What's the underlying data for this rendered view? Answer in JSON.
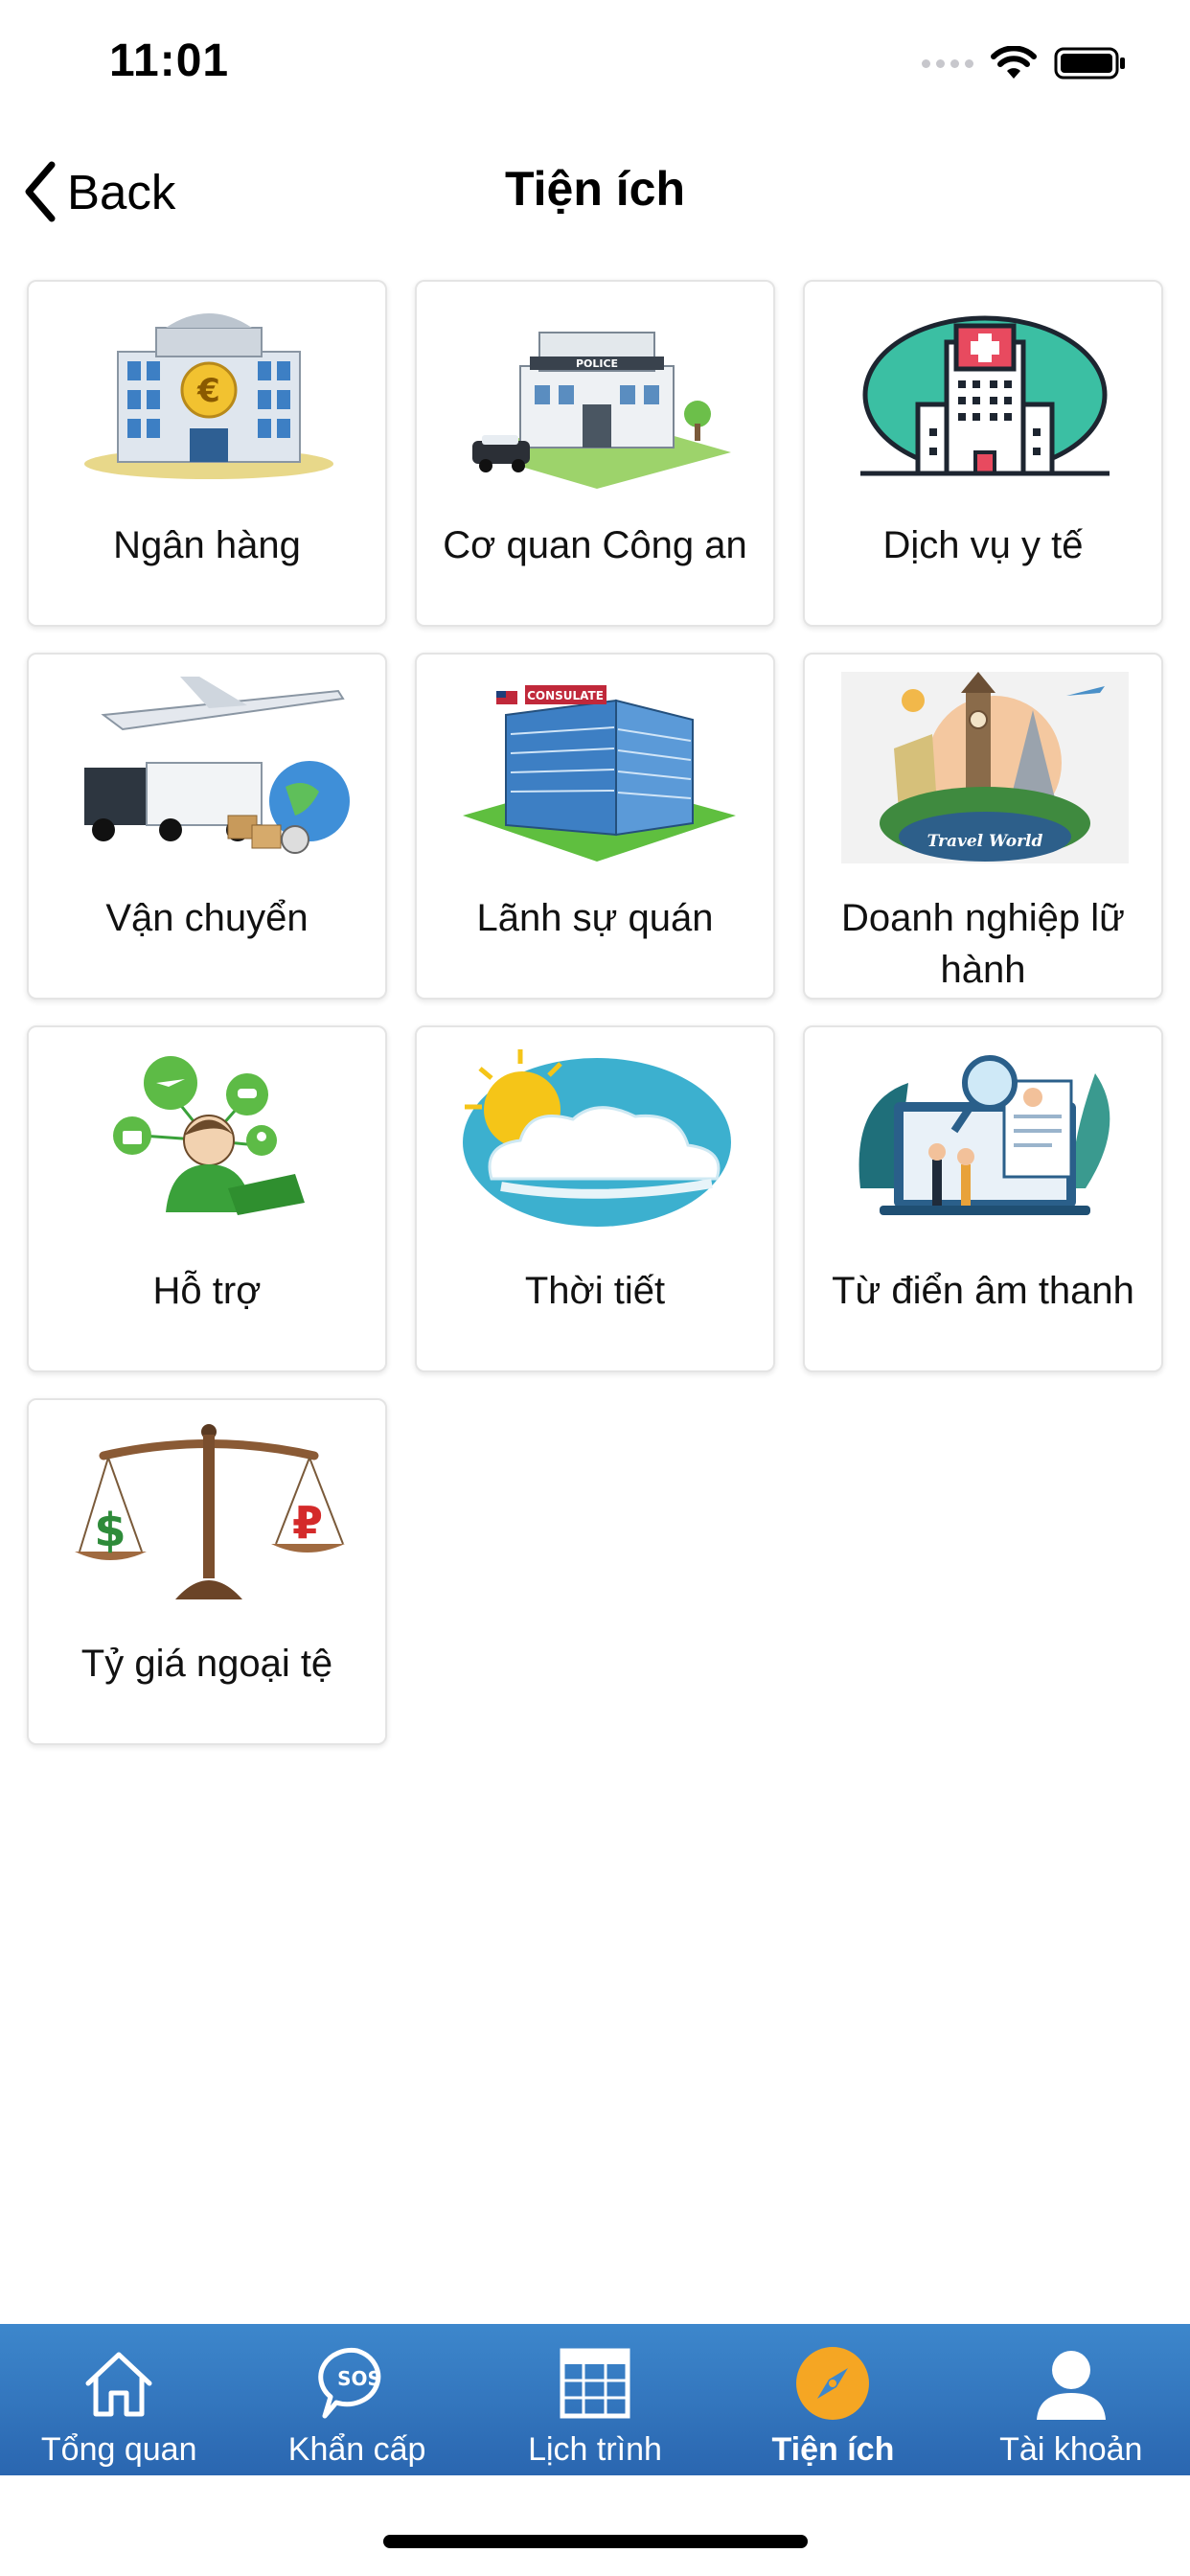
{
  "status_bar": {
    "time": "11:01"
  },
  "nav": {
    "back_label": "Back",
    "title": "Tiện ích"
  },
  "items": [
    {
      "label": "Ngân hàng",
      "icon": "bank-icon"
    },
    {
      "label": "Cơ quan Công an",
      "icon": "police-station-icon"
    },
    {
      "label": "Dịch vụ y tế",
      "icon": "hospital-icon"
    },
    {
      "label": "Vận chuyển",
      "icon": "transport-icon"
    },
    {
      "label": "Lãnh sự quán",
      "icon": "consulate-icon",
      "sign": "CONSULATE"
    },
    {
      "label": "Doanh nghiệp lữ hành",
      "icon": "travel-agency-icon",
      "sign": "Travel World"
    },
    {
      "label": "Hỗ trợ",
      "icon": "support-icon"
    },
    {
      "label": "Thời tiết",
      "icon": "weather-icon"
    },
    {
      "label": "Từ điển âm thanh",
      "icon": "audio-dictionary-icon"
    },
    {
      "label": "Tỷ giá ngoại tệ",
      "icon": "exchange-rate-icon"
    }
  ],
  "tabs": [
    {
      "label": "Tổng quan",
      "icon": "home-icon",
      "active": false
    },
    {
      "label": "Khẩn cấp",
      "icon": "sos-icon",
      "active": false
    },
    {
      "label": "Lịch trình",
      "icon": "calendar-grid-icon",
      "active": false
    },
    {
      "label": "Tiện ích",
      "icon": "compass-icon",
      "active": true
    },
    {
      "label": "Tài khoản",
      "icon": "user-icon",
      "active": false
    }
  ],
  "colors": {
    "tab_bar_top": "#3d87cc",
    "tab_bar_bottom": "#2a66b0",
    "active_tab_icon": "#f5a623"
  }
}
